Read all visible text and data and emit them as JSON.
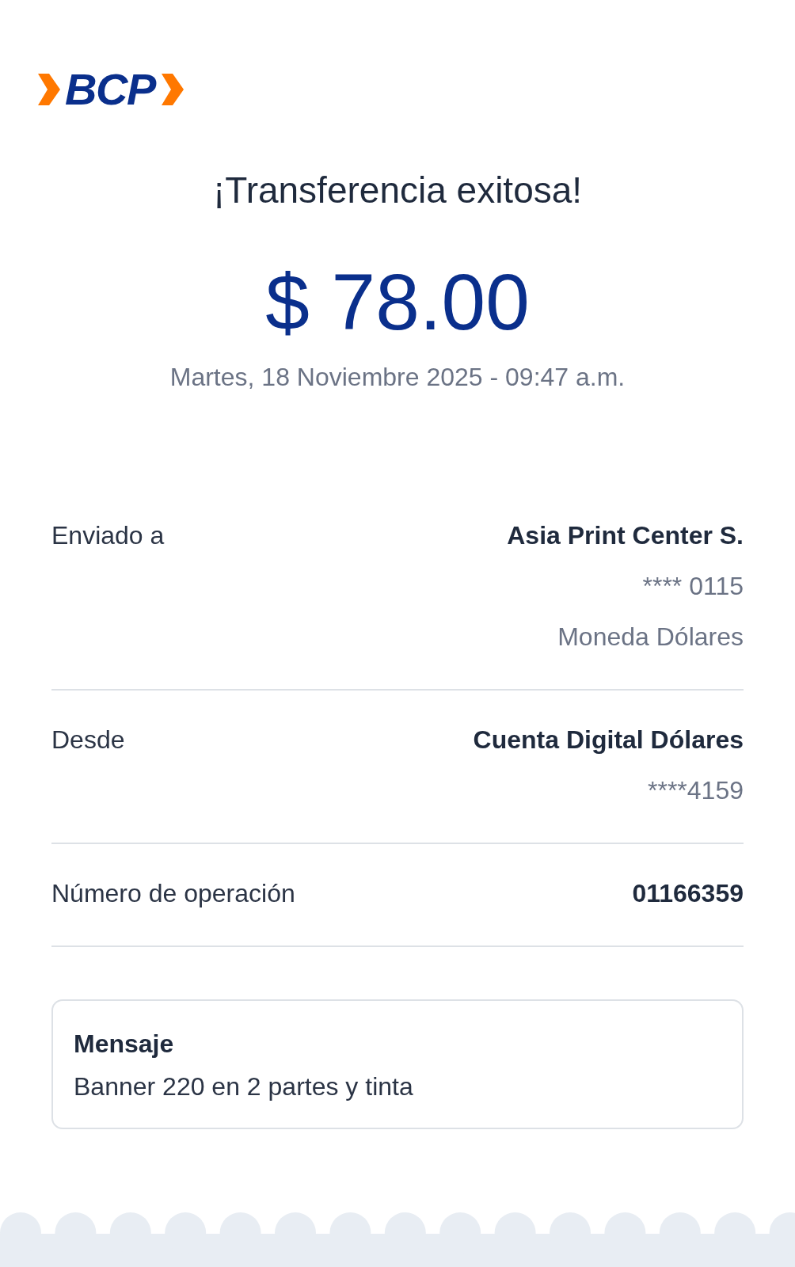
{
  "logo": {
    "text": "BCP"
  },
  "title": "¡Transferencia exitosa!",
  "amount": "$ 78.00",
  "datetime": "Martes, 18 Noviembre 2025 - 09:47 a.m.",
  "details": [
    {
      "label": "Enviado a",
      "value": "Asia Print Center S.",
      "extra": [
        "**** 0115",
        "Moneda Dólares"
      ]
    },
    {
      "label": "Desde",
      "value": "Cuenta Digital Dólares",
      "extra": [
        "****4159"
      ]
    },
    {
      "label": "Número de operación",
      "value": "01166359"
    }
  ],
  "message": {
    "title": "Mensaje",
    "text": "Banner 220 en 2 partes y tinta"
  }
}
